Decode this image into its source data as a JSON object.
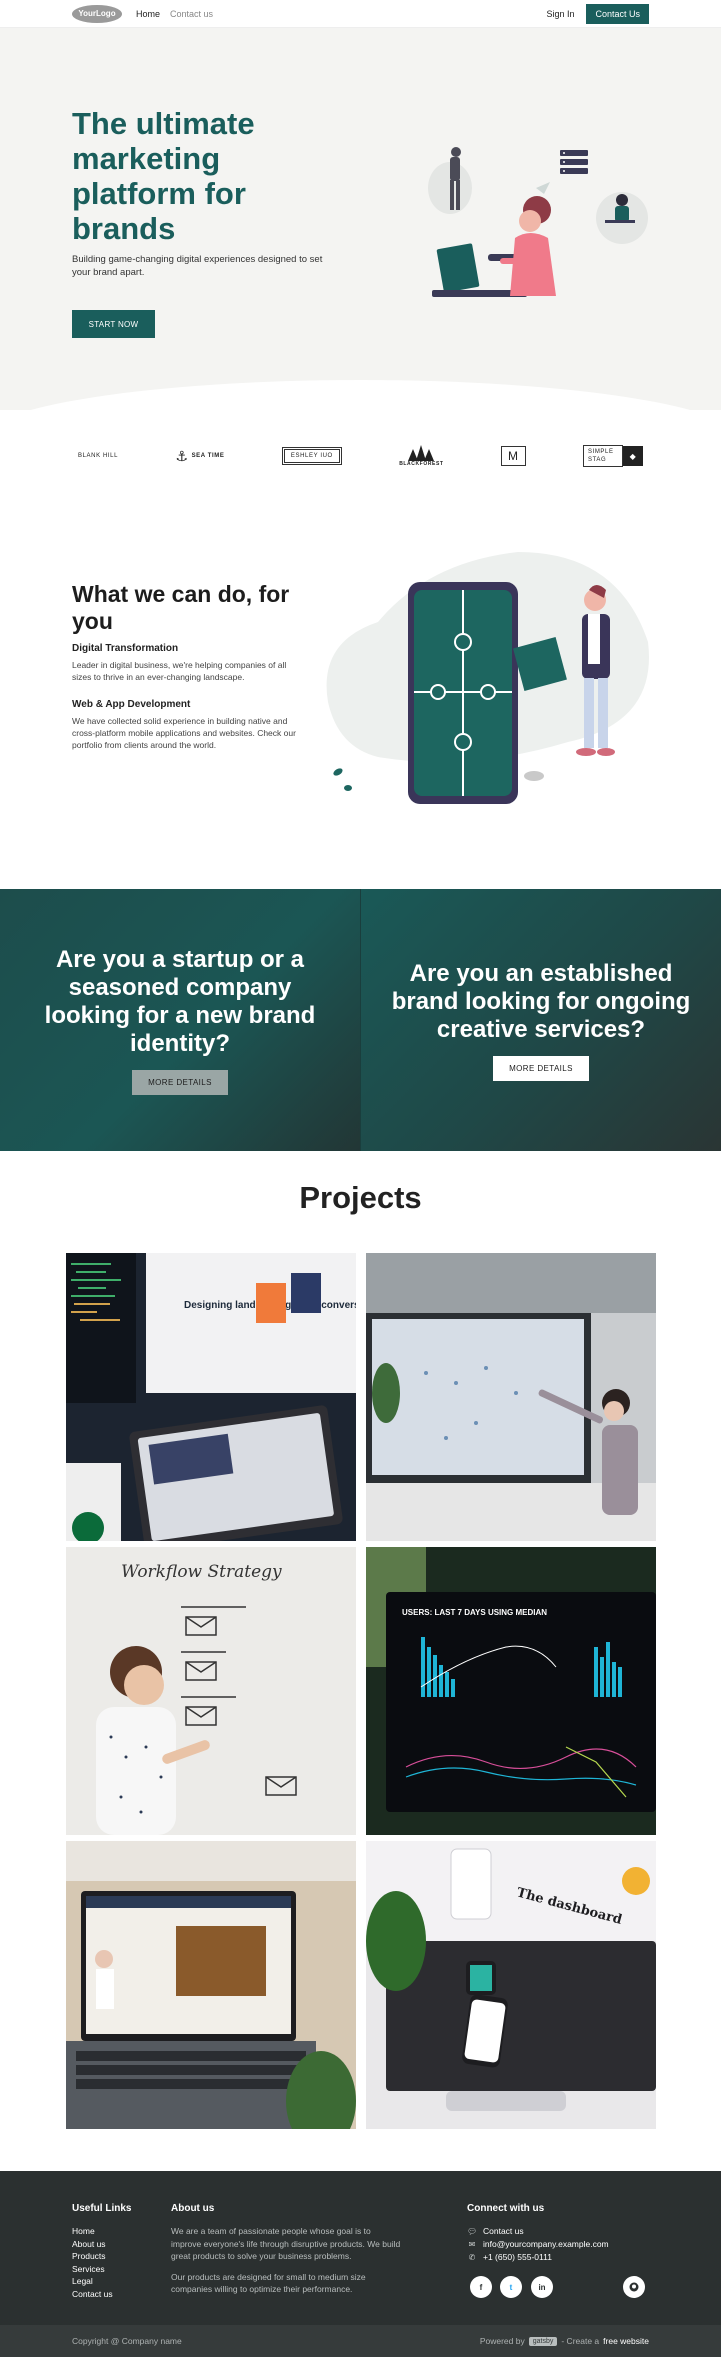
{
  "nav": {
    "logo": "YourLogo",
    "links": [
      "Home",
      "Contact us"
    ],
    "sign_in": "Sign In",
    "contact": "Contact Us"
  },
  "hero": {
    "title": "The ultimate marketing platform for brands",
    "subtitle": "Building game-changing digital experiences designed to set your brand apart.",
    "cta": "START NOW"
  },
  "brands": [
    "BLANK HILL",
    "SEA TIME",
    "ESHLEY IUO",
    "BLACKFOREST",
    "M",
    "SIMPLE STAG"
  ],
  "services": {
    "title": "What we can do, for you",
    "items": [
      {
        "heading": "Digital Transformation",
        "text": "Leader in digital business, we're helping companies of all sizes to thrive in an ever-changing landscape."
      },
      {
        "heading": "Web & App Development",
        "text": "We have collected solid experience in building native and cross-platform mobile applications and websites. Check our portfolio from clients around the world."
      }
    ]
  },
  "cta": [
    {
      "text": "Are you a startup or a seasoned company looking for a new brand identity?",
      "button": "MORE DETAILS"
    },
    {
      "text": "Are you an established brand looking for ongoing creative services?",
      "button": "MORE DETAILS"
    }
  ],
  "projects": {
    "title": "Projects",
    "items": [
      {
        "caption": "Designing landing pages for conversion"
      },
      {
        "caption": ""
      },
      {
        "caption": "Workflow Strategy"
      },
      {
        "caption": "USERS: LAST 7 DAYS USING MEDIAN"
      },
      {
        "caption": ""
      },
      {
        "caption": "The dashboard"
      }
    ]
  },
  "footer": {
    "useful_links_title": "Useful Links",
    "useful_links": [
      "Home",
      "About us",
      "Products",
      "Services",
      "Legal",
      "Contact us"
    ],
    "about_title": "About us",
    "about_p1": "We are a team of passionate people whose goal is to improve everyone's life through disruptive products. We build great products to solve your business problems.",
    "about_p2": "Our products are designed for small to medium size companies willing to optimize their performance.",
    "connect_title": "Connect with us",
    "contacts": [
      {
        "icon": "chat-icon",
        "text": "Contact us"
      },
      {
        "icon": "mail-icon",
        "text": "info@yourcompany.example.com"
      },
      {
        "icon": "phone-icon",
        "text": "+1 (650) 555-0111"
      }
    ],
    "social": [
      "f",
      "t",
      "in",
      "gh"
    ]
  },
  "subfooter": {
    "copyright": "Copyright @ Company name",
    "powered": "Powered by",
    "powered_brand": "gatsby",
    "create": "- Create a",
    "free_site": "free website"
  },
  "colors": {
    "brand": "#1a5e5c",
    "footer": "#2b3030",
    "accent_pink": "#f07a8a"
  }
}
